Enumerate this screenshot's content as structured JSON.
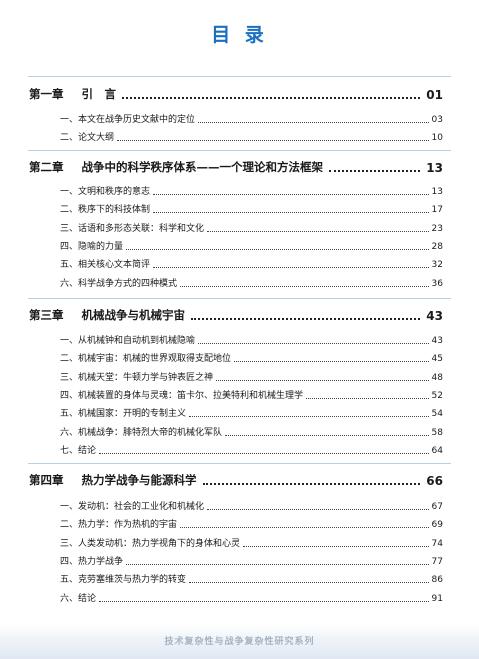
{
  "title": "目 录",
  "chapters": [
    {
      "label": "第一章",
      "title": "引　言",
      "page": "01",
      "sections": [
        {
          "label": "一、本文在战争历史文献中的定位",
          "page": "03"
        },
        {
          "label": "二、论文大纲",
          "page": "10"
        }
      ]
    },
    {
      "label": "第二章",
      "title": "战争中的科学秩序体系——一个理论和方法框架",
      "page": "13",
      "sections": [
        {
          "label": "一、文明和秩序的意志",
          "page": "13"
        },
        {
          "label": "二、秩序下的科技体制",
          "page": "17"
        },
        {
          "label": "三、话语和多形态关联：科学和文化",
          "page": "23"
        },
        {
          "label": "四、隐喻的力量",
          "page": "28"
        },
        {
          "label": "五、相关核心文本简评",
          "page": "32"
        },
        {
          "label": "六、科学战争方式的四种模式",
          "page": "36"
        }
      ]
    },
    {
      "label": "第三章",
      "title": "机械战争与机械宇宙",
      "page": "43",
      "sections": [
        {
          "label": "一、从机械钟和自动机到机械隐喻",
          "page": "43"
        },
        {
          "label": "二、机械宇宙：机械的世界观取得支配地位",
          "page": "45"
        },
        {
          "label": "三、机械天堂：牛顿力学与钟表匠之神",
          "page": "48"
        },
        {
          "label": "四、机械装置的身体与灵魂：笛卡尔、拉美特利和机械生理学",
          "page": "52"
        },
        {
          "label": "五、机械国家：开明的专制主义",
          "page": "54"
        },
        {
          "label": "六、机械战争：腓特烈大帝的机械化军队",
          "page": "58"
        },
        {
          "label": "七、结论",
          "page": "64"
        }
      ]
    },
    {
      "label": "第四章",
      "title": "热力学战争与能源科学",
      "page": "66",
      "sections": [
        {
          "label": "一、发动机：社会的工业化和机械化",
          "page": "67"
        },
        {
          "label": "二、热力学：作为热机的宇宙",
          "page": "69"
        },
        {
          "label": "三、人类发动机：热力学视角下的身体和心灵",
          "page": "74"
        },
        {
          "label": "四、热力学战争",
          "page": "77"
        },
        {
          "label": "五、克劳塞维茨与热力学的转变",
          "page": "86"
        },
        {
          "label": "六、结论",
          "page": "91"
        }
      ]
    }
  ],
  "footer": "技术复杂性与战争复杂性研究系列",
  "colors": {
    "title": "#1a6fc0",
    "separator": "#b8cfe6"
  }
}
